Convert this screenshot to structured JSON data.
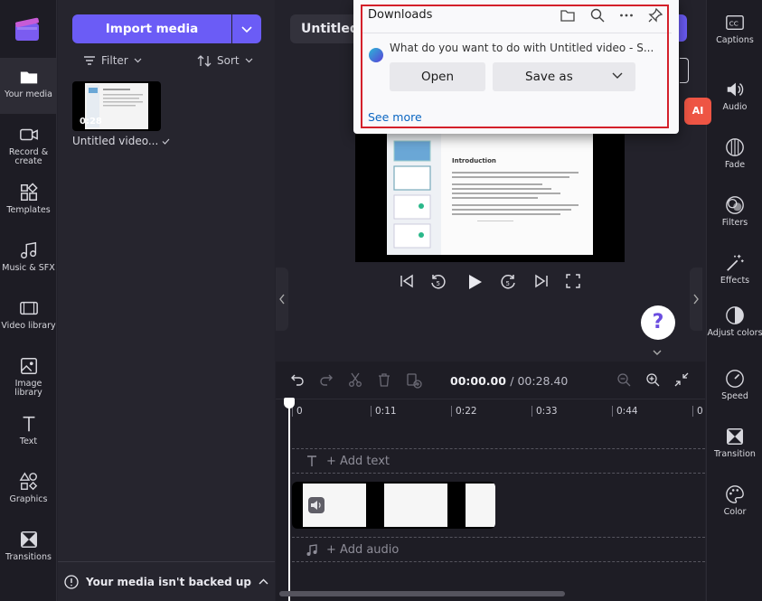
{
  "app": {
    "project_title": "Untitled v",
    "colors": {
      "accent": "#6b5cf6",
      "highlight_outline": "#d4202a",
      "link": "#0b66c2"
    }
  },
  "left_nav": [
    {
      "label": "Your media",
      "icon": "folder-icon",
      "active": true
    },
    {
      "label": "Record & create",
      "icon": "camera-icon"
    },
    {
      "label": "Templates",
      "icon": "templates-icon"
    },
    {
      "label": "Music & SFX",
      "icon": "music-icon"
    },
    {
      "label": "Video library",
      "icon": "film-icon"
    },
    {
      "label": "Image library",
      "icon": "image-icon"
    },
    {
      "label": "Text",
      "icon": "text-icon"
    },
    {
      "label": "Graphics",
      "icon": "shapes-icon"
    },
    {
      "label": "Transitions",
      "icon": "transition-icon"
    }
  ],
  "media_panel": {
    "import_label": "Import media",
    "filter_label": "Filter",
    "sort_label": "Sort",
    "item": {
      "duration": "0:28",
      "name": "Untitled video..."
    },
    "backup_notice": "Your media isn't backed up"
  },
  "right_nav": [
    {
      "label": "Captions",
      "icon": "cc-icon"
    },
    {
      "label": "Audio",
      "icon": "speaker-icon"
    },
    {
      "label": "Fade",
      "icon": "fade-icon"
    },
    {
      "label": "Filters",
      "icon": "filters-icon"
    },
    {
      "label": "Effects",
      "icon": "wand-icon"
    },
    {
      "label": "Adjust colors",
      "icon": "contrast-icon"
    },
    {
      "label": "Speed",
      "icon": "speedometer-icon"
    },
    {
      "label": "Transition",
      "icon": "transition-icon"
    },
    {
      "label": "Color",
      "icon": "palette-icon"
    }
  ],
  "ai_badge": "AI",
  "help_label": "?",
  "preview": {
    "slide_heading": "Introduction"
  },
  "timeline": {
    "current_time": "00:00.00",
    "total_time": "/ 00:28.40",
    "ticks": [
      "0",
      "0:11",
      "0:22",
      "0:33",
      "0:44",
      "0"
    ],
    "add_text": "+ Add text",
    "add_audio": "+ Add audio"
  },
  "downloads": {
    "title": "Downloads",
    "message": "What do you want to do with Untitled video - S...",
    "open_label": "Open",
    "save_as_label": "Save as",
    "see_more": "See more"
  }
}
